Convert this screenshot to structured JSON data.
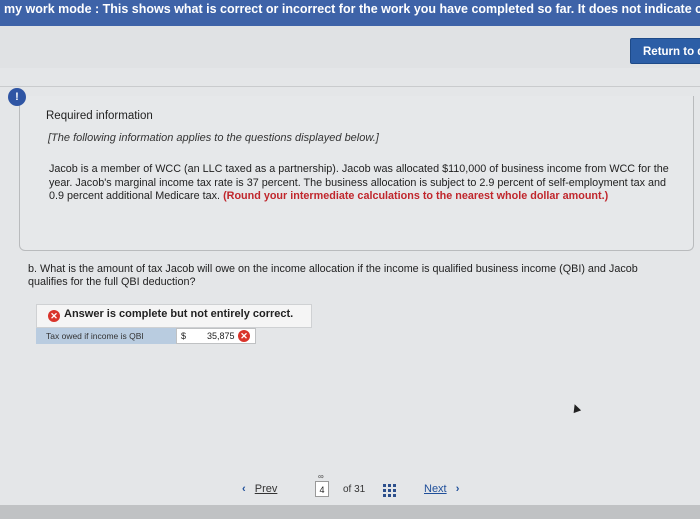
{
  "top_banner": {
    "text": "my work mode : This shows what is correct or incorrect for the work you have completed so far. It does not indicate completio"
  },
  "return_button": {
    "label": "Return to qu"
  },
  "alert": {
    "symbol": "!"
  },
  "required_info": {
    "title": "Required information",
    "subtitle": "[The following information applies to the questions displayed below.]",
    "body": "Jacob is a member of WCC (an LLC taxed as a partnership). Jacob was allocated $110,000 of business income from WCC for the year. Jacob's marginal income tax rate is 37 percent. The business allocation is subject to 2.9 percent of self-employment tax and 0.9 percent additional Medicare tax. ",
    "emphasis": "(Round your intermediate calculations to the nearest whole dollar amount.)"
  },
  "question": {
    "text": "b. What is the amount of tax Jacob will owe on the income allocation if the income is qualified business income (QBI) and Jacob qualifies for the full QBI deduction?"
  },
  "answer": {
    "banner": "Answer is complete but not entirely correct.",
    "row_label": "Tax owed if income is QBI",
    "currency": "$",
    "value": "35,875"
  },
  "pagination": {
    "prev": "Prev",
    "current": "4",
    "of_text": "of 31",
    "next": "Next"
  },
  "colors": {
    "header_blue": "#3e63a8",
    "error_red": "#d9342b",
    "emphasis_red": "#c0262c"
  }
}
